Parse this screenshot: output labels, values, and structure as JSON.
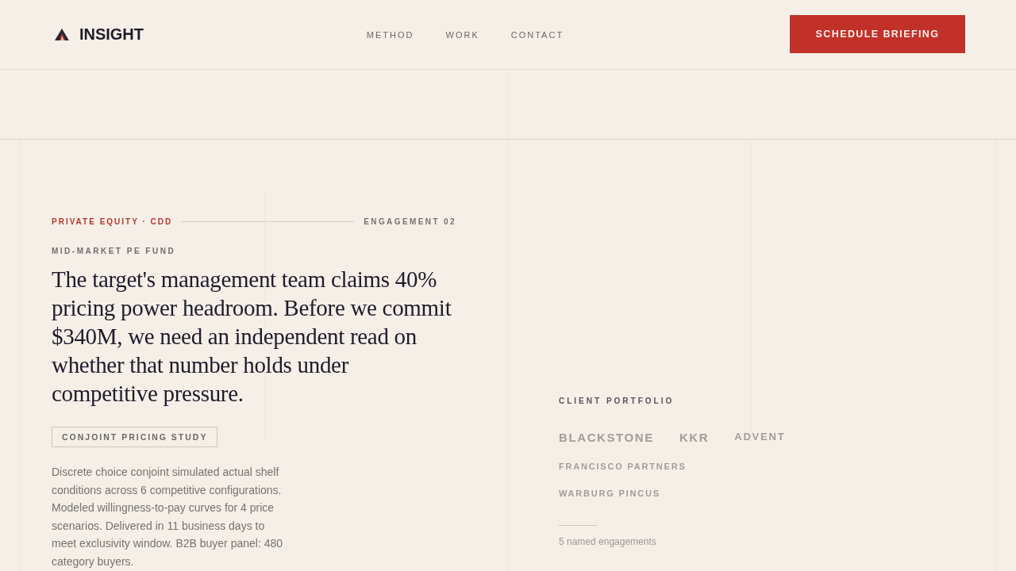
{
  "header": {
    "brand": "INSIGHT",
    "nav": [
      "METHOD",
      "WORK",
      "CONTACT"
    ],
    "cta": "SCHEDULE BRIEFING"
  },
  "case": {
    "category": "PRIVATE EQUITY · CDD",
    "engagement": "ENGAGEMENT 02",
    "client_type": "MID-MARKET PE FUND",
    "headline": "The target's management team claims 40% pricing power headroom. Before we commit $340M, we need an independent read on whether that number holds under competitive pressure.",
    "method_tag": "CONJOINT PRICING STUDY",
    "summary": "Discrete choice conjoint simulated actual shelf conditions across 6 competitive configurations. Modeled willingness-to-pay curves for 4 price scenarios. Delivered in 11 business days to meet exclusivity window. B2B buyer panel: 480 category buyers."
  },
  "portfolio": {
    "title": "CLIENT PORTFOLIO",
    "clients": [
      {
        "name": "BLACKSTONE",
        "kind": "large"
      },
      {
        "name": "KKR",
        "kind": "large"
      },
      {
        "name": "ADVENT",
        "kind": "medium"
      },
      {
        "name": "FRANCISCO PARTNERS",
        "kind": "small"
      },
      {
        "name": "WARBURG PINCUS",
        "kind": "small"
      }
    ],
    "footnote": "5 named engagements"
  }
}
